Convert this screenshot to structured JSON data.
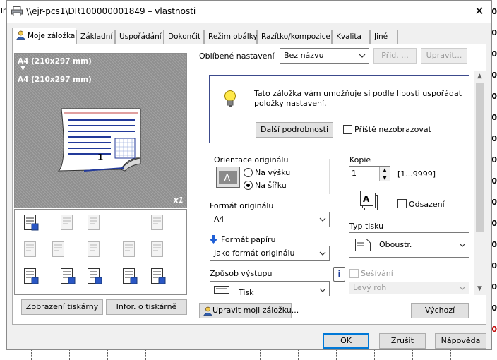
{
  "background": {
    "left_cell_text": "Ir",
    "right_numbers": [
      "0",
      "0",
      "0",
      "0",
      "0",
      "0",
      "0",
      "0",
      "0",
      "0",
      "0",
      "0",
      "0",
      "0",
      "0",
      "0",
      "0",
      "0"
    ]
  },
  "window": {
    "title": "\\\\ejr-pcs1\\DR100000001849 – vlastnosti",
    "close_label": "✕"
  },
  "tabs": [
    {
      "label": "Moje záložka",
      "active": true
    },
    {
      "label": "Základní"
    },
    {
      "label": "Uspořádání"
    },
    {
      "label": "Dokončit"
    },
    {
      "label": "Režim obálky"
    },
    {
      "label": "Razítko/kompozice"
    },
    {
      "label": "Kvalita"
    },
    {
      "label": "Jiné"
    }
  ],
  "preview": {
    "line1": "A4 (210x297 mm)",
    "arrow": "▼",
    "line2": "A4 (210x297 mm)",
    "page_number": "1",
    "copies": "x1"
  },
  "left_buttons": {
    "printer_view": "Zobrazení tiskárny",
    "printer_info": "Infor. o tiskárně"
  },
  "favorites": {
    "label": "Oblíbené nastavení",
    "value": "Bez názvu",
    "add_label": "Přid. ...",
    "edit_label": "Upravit..."
  },
  "info": {
    "text_line1": "Tato záložka vám umožňuje si podle libosti uspořádat",
    "text_line2": "položky nastavení.",
    "details_button": "Další podrobnosti",
    "dont_show_label": "Příště nezobrazovat"
  },
  "orientation": {
    "label": "Orientace originálu",
    "portrait": "Na výšku",
    "landscape": "Na šířku",
    "selected": "landscape"
  },
  "original_size": {
    "label": "Formát originálu",
    "value": "A4"
  },
  "paper_size": {
    "label": "Formát papíru",
    "value": "Jako formát originálu"
  },
  "output": {
    "label": "Způsob výstupu",
    "value": "Tisk"
  },
  "copies": {
    "label": "Kopie",
    "value": "1",
    "range": "[1...9999]",
    "offset_label": "Odsazení"
  },
  "print_type": {
    "label": "Typ tisku",
    "value": "Oboustr."
  },
  "stapling": {
    "label": "Sešívání",
    "value": "Levý roh",
    "info_icon": "i"
  },
  "bottom": {
    "edit_tab_button": "Upravit moji záložku...",
    "default_button": "Výchozí",
    "ok": "OK",
    "cancel": "Zrušit",
    "help": "Nápověda"
  },
  "colors": {
    "accent": "#0078d7",
    "info_border": "#3c4a8c",
    "paper_arrow": "#1f5fd6"
  }
}
